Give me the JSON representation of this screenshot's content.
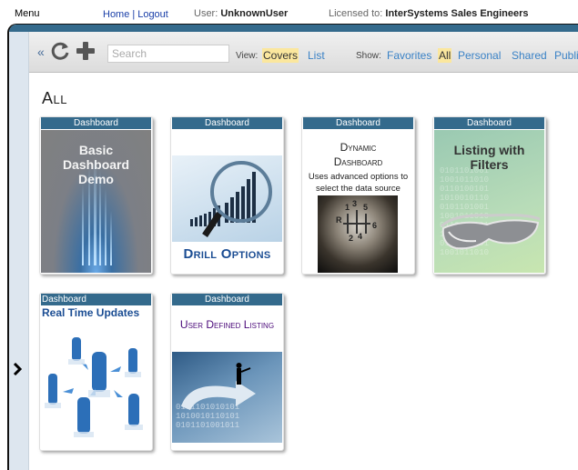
{
  "topbar": {
    "menu_label": "Menu",
    "home_link": "Home",
    "separator": "|",
    "logout_link": "Logout",
    "user_label": "User:",
    "user_name": "UnknownUser",
    "license_label": "Licensed to:",
    "license_name": "InterSystems Sales Engineers"
  },
  "toolbar": {
    "collapse_icon": "«",
    "refresh_icon": "refresh-icon",
    "add_icon": "plus-icon",
    "search_placeholder": "Search",
    "search_value": "",
    "view_label": "View:",
    "view_options": [
      {
        "label": "Covers",
        "selected": true
      },
      {
        "label": "List",
        "selected": false
      }
    ],
    "show_label": "Show:",
    "show_options": [
      {
        "label": "Favorites",
        "selected": false
      },
      {
        "label": "All",
        "selected": true
      },
      {
        "label": "Personal",
        "selected": false
      },
      {
        "label": "Shared",
        "selected": false
      },
      {
        "label": "Publi",
        "selected": false
      }
    ]
  },
  "sidebar": {
    "expand_icon": "›"
  },
  "content": {
    "section_title": "All",
    "cards": [
      {
        "type": "Dashboard",
        "title": "Basic Dashboard Demo"
      },
      {
        "type": "Dashboard",
        "title": "Drill Options"
      },
      {
        "type": "Dashboard",
        "title": "Dynamic Dashboard",
        "subtitle": "Uses advanced options to select the data source"
      },
      {
        "type": "Dashboard",
        "title": "Listing with Filters"
      },
      {
        "type": "Dashboard",
        "title": "Real Time Updates"
      },
      {
        "type": "Dashboard",
        "title": "User Defined Listing"
      }
    ]
  },
  "colors": {
    "header_blue": "#346a8c",
    "link_blue": "#3a82c6",
    "selected_highlight": "#fbe79e",
    "sidebar_bg": "#dde6ef"
  }
}
